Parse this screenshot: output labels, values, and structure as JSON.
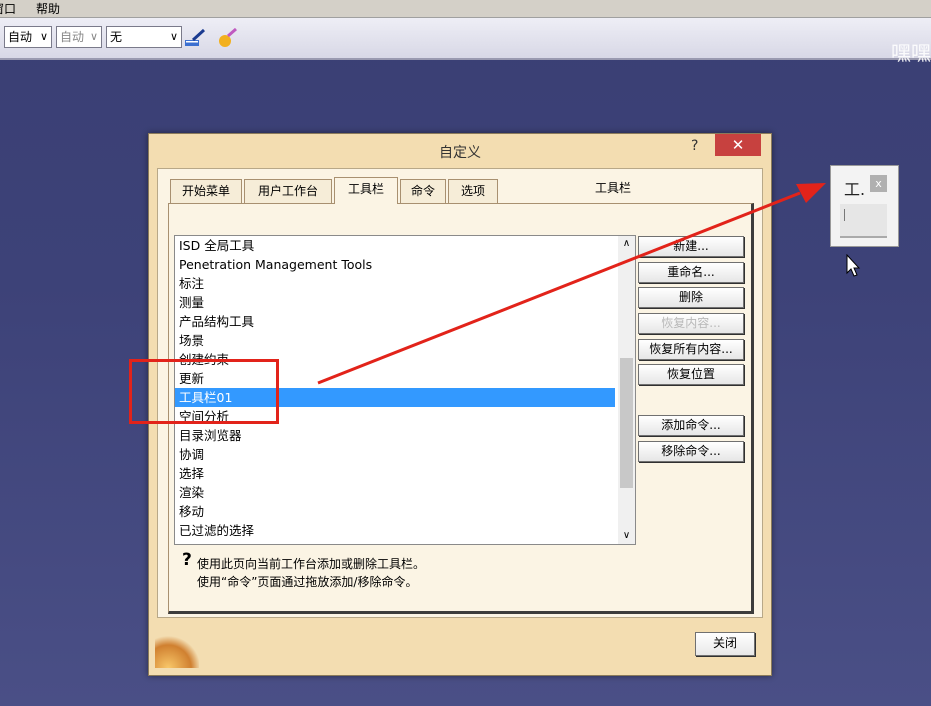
{
  "menubar": {
    "items": [
      "窗口",
      "帮助"
    ]
  },
  "toolbar": {
    "combo1": "自动",
    "combo2": "自动",
    "combo3": "无",
    "watermark": "嘿嘿"
  },
  "dialog": {
    "title": "自定义",
    "help": "?",
    "close_x": "✕",
    "tabs": [
      "开始菜单",
      "用户工作台",
      "工具栏",
      "命令",
      "选项"
    ],
    "list_caption": "工具栏",
    "list_items": [
      "ISD 全局工具",
      "Penetration Management Tools",
      "标注",
      "测量",
      "产品结构工具",
      "场景",
      "创建约束",
      "更新",
      "工具栏01",
      "空间分析",
      "目录浏览器",
      "协调",
      "选择",
      "渲染",
      "移动",
      "已过滤的选择"
    ],
    "selected_item": "工具栏01",
    "buttons": {
      "new": "新建...",
      "rename": "重命名...",
      "delete": "删除",
      "restore_content": "恢复内容...",
      "restore_all": "恢复所有内容...",
      "restore_position": "恢复位置",
      "add_command": "添加命令...",
      "remove_command": "移除命令..."
    },
    "hint_line1": "使用此页向当前工作台添加或删除工具栏。",
    "hint_line2": "使用“命令”页面通过拖放添加/移除命令。",
    "close_button": "关闭"
  },
  "floating_toolbar": {
    "title": "工.",
    "close": "x"
  },
  "colors": {
    "highlight": "#e2231a",
    "selection": "#3399ff",
    "dialog_bg": "#f3ddb1"
  }
}
